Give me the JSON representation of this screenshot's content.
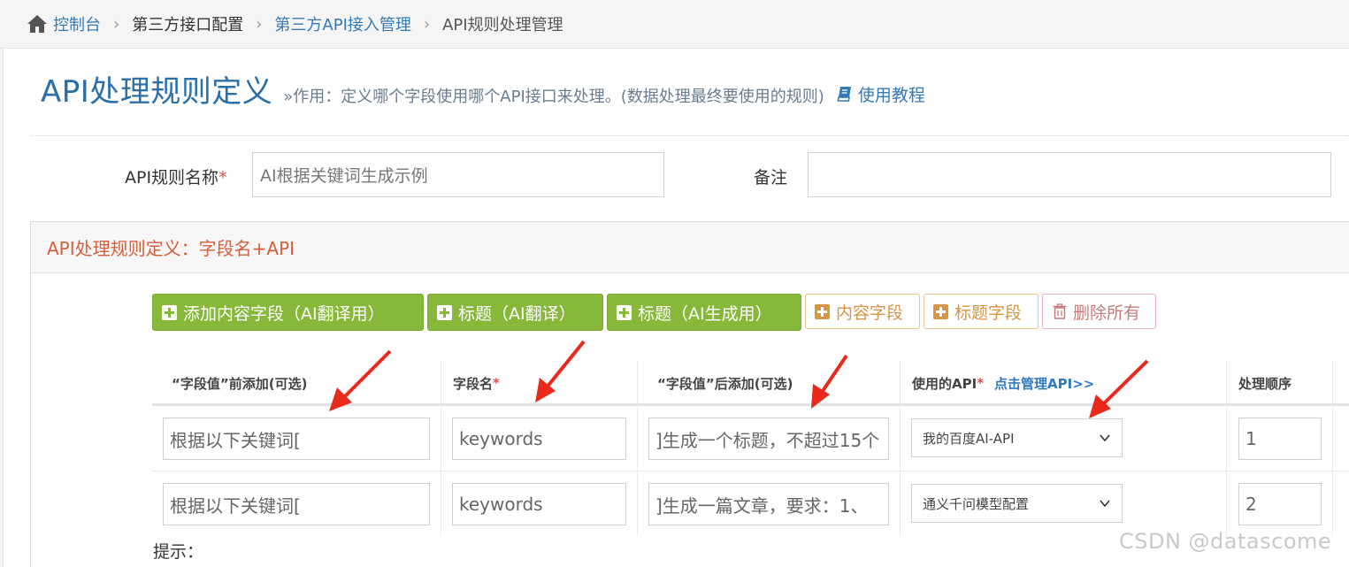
{
  "breadcrumb": {
    "home_icon": "home-icon",
    "items": [
      "控制台",
      "第三方接口配置",
      "第三方API接入管理",
      "API规则处理管理"
    ],
    "separator": ">"
  },
  "header": {
    "title": "API处理规则定义",
    "description": "»作用：定义哪个字段使用哪个API接口来处理。(数据处理最终要使用的规则)",
    "tutorial_icon": "book-icon",
    "tutorial_label": "使用教程"
  },
  "form": {
    "rule_name_label": "API规则名称",
    "required_mark": "*",
    "rule_name_value": "AI根据关键词生成示例",
    "remark_label": "备注",
    "remark_value": ""
  },
  "panel": {
    "title": "API处理规则定义：字段名+API",
    "buttons": [
      "添加内容字段（AI翻译用）",
      "标题（AI翻译）",
      "标题（AI生成用）",
      "内容字段",
      "标题字段",
      "删除所有"
    ],
    "columns": {
      "prefix": "“字段值”前添加(可选)",
      "field_name": "字段名",
      "suffix": "“字段值”后添加(可选)",
      "api": "使用的API",
      "api_link": "点击管理API>>",
      "order": "处理顺序"
    },
    "rows": [
      {
        "prefix": "根据以下关键词[",
        "field_name": "keywords",
        "suffix": "]生成一个标题，不超过15个",
        "api": "我的百度AI-API",
        "order": "1"
      },
      {
        "prefix": "根据以下关键词[",
        "field_name": "keywords",
        "suffix": "]生成一篇文章，要求：1、",
        "api": "通义千问模型配置",
        "order": "2"
      }
    ],
    "hint_label": "提示："
  },
  "watermark": "CSDN @datascome",
  "colors": {
    "accent": "#2b6fa8",
    "panel_title": "#d35f3c",
    "green_button": "#87b83a",
    "warning_button": "#d89544",
    "danger_button": "#c97a7a",
    "annotation_arrow": "#e8291c"
  }
}
